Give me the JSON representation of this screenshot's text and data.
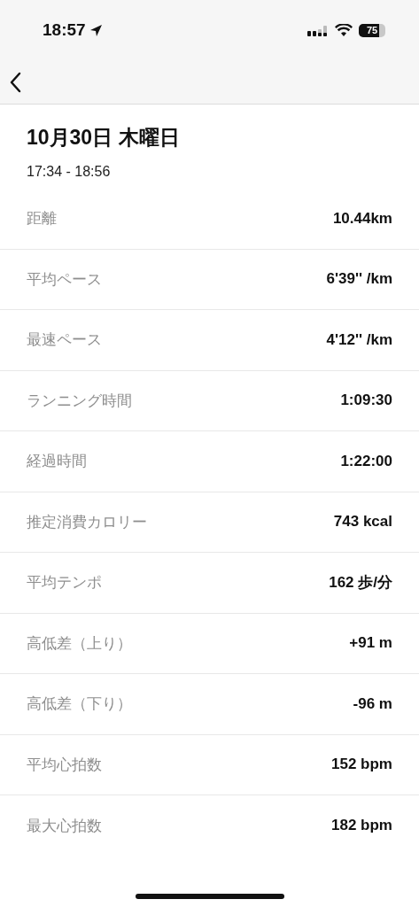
{
  "status_bar": {
    "time": "18:57",
    "battery": "75"
  },
  "header": {
    "title": "10月30日 木曜日",
    "time_range": "17:34 - 18:56"
  },
  "stats": [
    {
      "label": "距離",
      "value": "10.44km"
    },
    {
      "label": "平均ペース",
      "value": "6'39'' /km"
    },
    {
      "label": "最速ペース",
      "value": "4'12'' /km"
    },
    {
      "label": "ランニング時間",
      "value": "1:09:30"
    },
    {
      "label": "経過時間",
      "value": "1:22:00"
    },
    {
      "label": "推定消費カロリー",
      "value": "743 kcal"
    },
    {
      "label": "平均テンポ",
      "value": "162 歩/分"
    },
    {
      "label": "高低差（上り）",
      "value": "+91 m"
    },
    {
      "label": "高低差（下り）",
      "value": "-96 m"
    },
    {
      "label": "平均心拍数",
      "value": "152 bpm"
    },
    {
      "label": "最大心拍数",
      "value": "182 bpm"
    }
  ]
}
